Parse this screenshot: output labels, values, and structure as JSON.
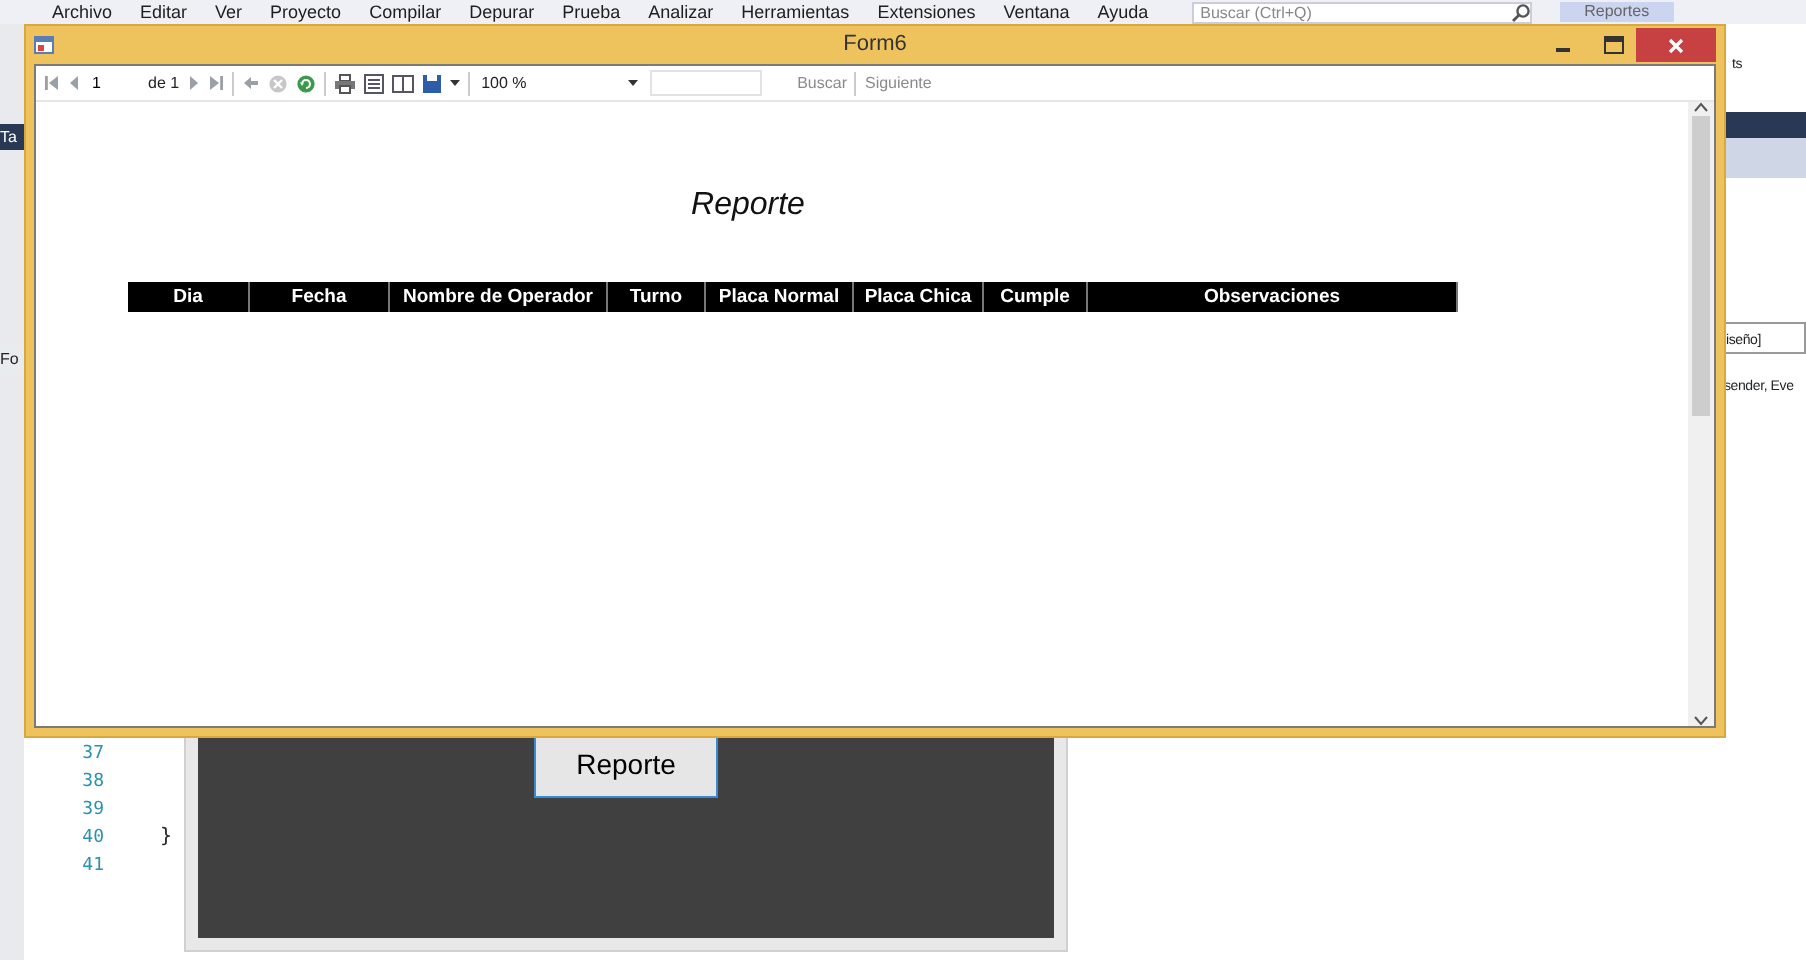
{
  "ide": {
    "menu": [
      "Archivo",
      "Editar",
      "Ver",
      "Proyecto",
      "Compilar",
      "Depurar",
      "Prueba",
      "Analizar",
      "Herramientas",
      "Extensiones",
      "Ventana",
      "Ayuda"
    ],
    "search": {
      "placeholder": "Buscar (Ctrl+Q)"
    },
    "reportes_tab": "Reportes",
    "left_fragments": [
      "Ta",
      "Fo"
    ],
    "right_fragments": [
      "ts",
      "iseño]",
      "sender, Eve"
    ],
    "code": {
      "line_numbers": [
        "37",
        "38",
        "39",
        "40",
        "41"
      ],
      "closing_brace": "}"
    },
    "designer": {
      "button": "Reporte"
    }
  },
  "window": {
    "title": "Form6",
    "toolbar": {
      "page": "1",
      "page_of": "de 1",
      "zoom": "100 %",
      "find": "Buscar",
      "find_next": "Siguiente",
      "find_disabled": true
    },
    "report": {
      "title": "Reporte",
      "columns": [
        "Dia",
        "Fecha",
        "Nombre de Operador",
        "Turno",
        "Placa Normal",
        "Placa Chica",
        "Cumple",
        "Observaciones"
      ]
    }
  }
}
